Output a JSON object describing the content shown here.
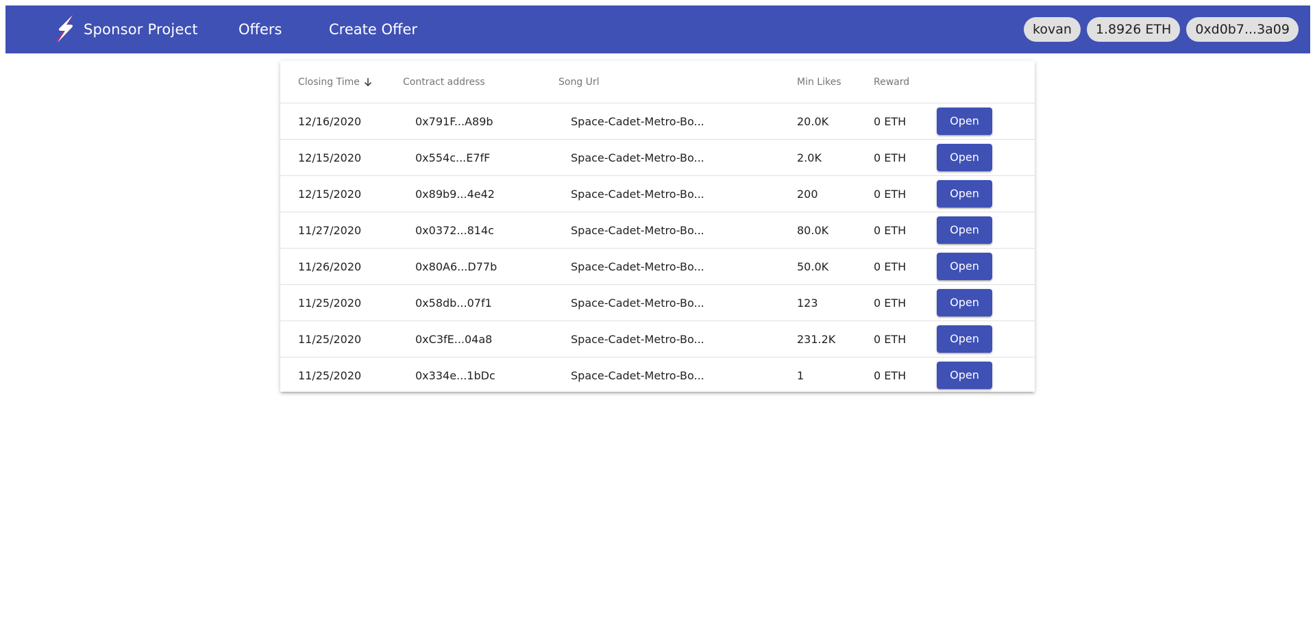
{
  "header": {
    "brand": "Sponsor Project",
    "nav": [
      {
        "label": "Offers"
      },
      {
        "label": "Create Offer"
      }
    ],
    "network": "kovan",
    "balance": "1.8926 ETH",
    "account": "0xd0b7...3a09"
  },
  "table": {
    "columns": [
      "Closing Time",
      "Contract address",
      "Song Url",
      "Min Likes",
      "Reward"
    ],
    "sort": {
      "column": "Closing Time",
      "direction": "desc",
      "icon": "arrow-down-icon"
    },
    "action_label": "Open",
    "rows": [
      {
        "time": "12/16/2020",
        "address": "0x791F...A89b",
        "song": "Space-Cadet-Metro-Bo...",
        "likes": "20.0K",
        "reward": "0 ETH"
      },
      {
        "time": "12/15/2020",
        "address": "0x554c...E7fF",
        "song": "Space-Cadet-Metro-Bo...",
        "likes": "2.0K",
        "reward": "0 ETH"
      },
      {
        "time": "12/15/2020",
        "address": "0x89b9...4e42",
        "song": "Space-Cadet-Metro-Bo...",
        "likes": "200",
        "reward": "0 ETH"
      },
      {
        "time": "11/27/2020",
        "address": "0x0372...814c",
        "song": "Space-Cadet-Metro-Bo...",
        "likes": "80.0K",
        "reward": "0 ETH"
      },
      {
        "time": "11/26/2020",
        "address": "0x80A6...D77b",
        "song": "Space-Cadet-Metro-Bo...",
        "likes": "50.0K",
        "reward": "0 ETH"
      },
      {
        "time": "11/25/2020",
        "address": "0x58db...07f1",
        "song": "Space-Cadet-Metro-Bo...",
        "likes": "123",
        "reward": "0 ETH"
      },
      {
        "time": "11/25/2020",
        "address": "0xC3fE...04a8",
        "song": "Space-Cadet-Metro-Bo...",
        "likes": "231.2K",
        "reward": "0 ETH"
      },
      {
        "time": "11/25/2020",
        "address": "0x334e...1bDc",
        "song": "Space-Cadet-Metro-Bo...",
        "likes": "1",
        "reward": "0 ETH"
      }
    ]
  },
  "colors": {
    "primary": "#3f51b5",
    "chip_bg": "#e0e0e0",
    "logo_accent": "#e91e63"
  }
}
